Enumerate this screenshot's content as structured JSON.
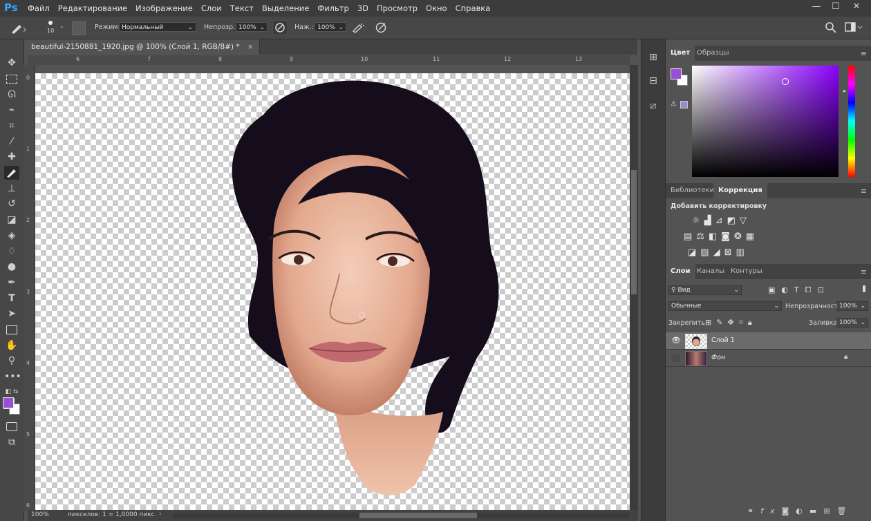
{
  "app": {
    "logo": "Ps"
  },
  "menu": [
    "Файл",
    "Редактирование",
    "Изображение",
    "Слои",
    "Текст",
    "Выделение",
    "Фильтр",
    "3D",
    "Просмотр",
    "Окно",
    "Справка"
  ],
  "window_controls": {
    "minimize": "—",
    "maximize": "☐",
    "close": "✕"
  },
  "options": {
    "brush_size": "10",
    "mode_label": "Режим:",
    "mode_value": "Нормальный",
    "opacity_label": "Непрозр.:",
    "opacity_value": "100%",
    "pressure_label": "Наж.:",
    "pressure_value": "100%"
  },
  "document": {
    "tab_title": "beautiful-2150881_1920.jpg @ 100% (Слой 1, RGB/8#) *",
    "close": "×"
  },
  "ruler_top": [
    "6",
    "7",
    "8",
    "9",
    "10",
    "11",
    "12",
    "13"
  ],
  "ruler_left": [
    "0",
    "1",
    "2",
    "3",
    "4",
    "5",
    "6"
  ],
  "status": {
    "zoom": "100%",
    "info": "пикселов: 1 = 1,0000 пикс."
  },
  "color_panel": {
    "tabs": [
      "Цвет",
      "Образцы"
    ],
    "foreground": "#9b4fd6",
    "background": "#ffffff"
  },
  "adjustments_panel": {
    "tabs": [
      "Библиотеки",
      "Коррекция"
    ],
    "heading": "Добавить корректировку"
  },
  "layers_panel": {
    "tabs": [
      "Слои",
      "Каналы",
      "Контуры"
    ],
    "filter": "Вид",
    "blend_mode": "Обычные",
    "opacity_label": "Непрозрачность:",
    "opacity_value": "100%",
    "lock_label": "Закрепить:",
    "fill_label": "Заливка:",
    "fill_value": "100%",
    "layers": [
      {
        "name": "Слой 1",
        "visible": true,
        "selected": true,
        "locked": false
      },
      {
        "name": "Фон",
        "visible": false,
        "selected": false,
        "locked": true
      }
    ]
  },
  "colors": {
    "accent": "#31a8ff",
    "chrome_dark": "#3c3c3c",
    "panel": "#535353",
    "selected_row": "#6b6b6b"
  }
}
